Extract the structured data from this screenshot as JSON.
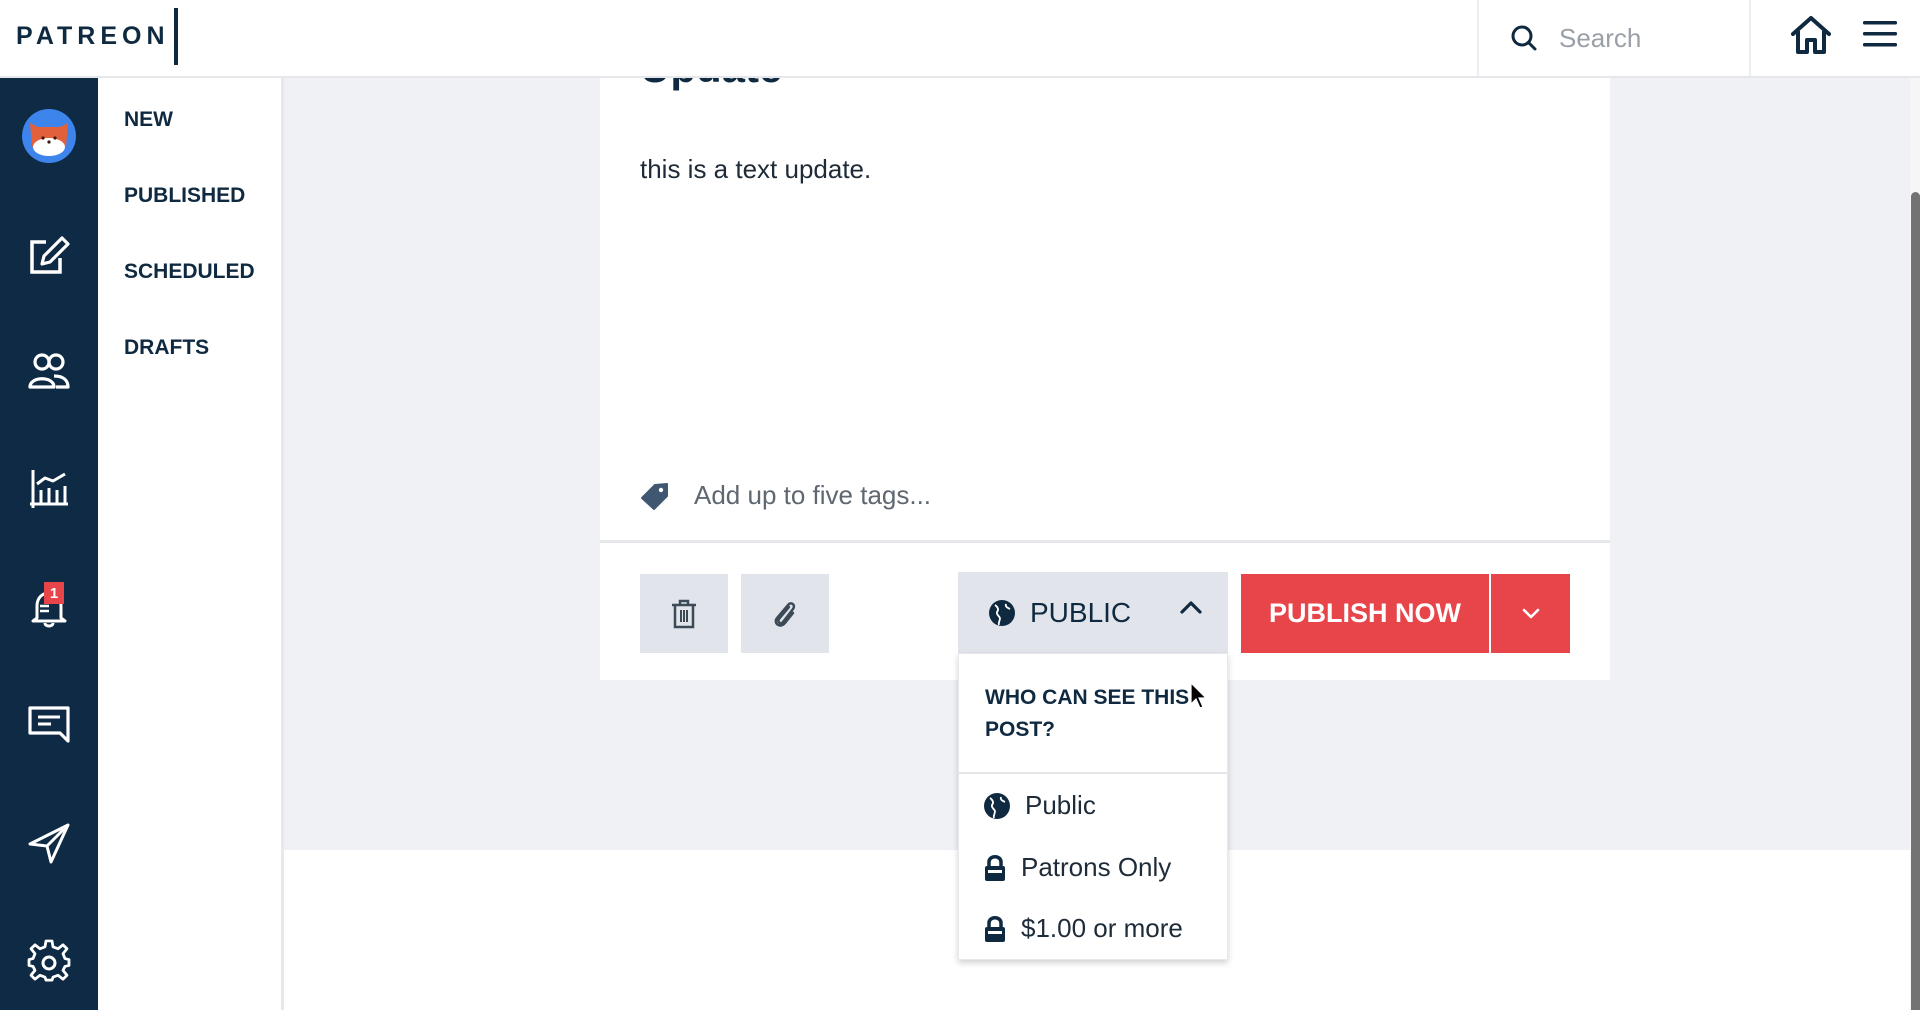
{
  "header": {
    "logo": "PATREON",
    "search": {
      "placeholder": "Search",
      "value": ""
    },
    "icons": [
      "search-icon",
      "home-icon",
      "hamburger-menu-icon"
    ]
  },
  "rail": {
    "items": [
      {
        "name": "avatar",
        "icon": "fox-avatar"
      },
      {
        "name": "posts",
        "icon": "edit-icon"
      },
      {
        "name": "patrons",
        "icon": "users-icon"
      },
      {
        "name": "insights",
        "icon": "chart-icon"
      },
      {
        "name": "notifications",
        "icon": "bell-icon",
        "badge": "1"
      },
      {
        "name": "messages",
        "icon": "message-icon"
      },
      {
        "name": "promote",
        "icon": "send-icon"
      },
      {
        "name": "settings",
        "icon": "gear-icon"
      }
    ]
  },
  "subnav": {
    "items": [
      {
        "label": "NEW"
      },
      {
        "label": "PUBLISHED"
      },
      {
        "label": "SCHEDULED"
      },
      {
        "label": "DRAFTS"
      }
    ]
  },
  "post": {
    "title": "Update",
    "body": "this is a text update.",
    "tags": {
      "placeholder": "Add up to five tags...",
      "value": ""
    }
  },
  "actions": {
    "delete_icon": "trash-icon",
    "attach_icon": "paperclip-icon",
    "privacy_label": "PUBLIC",
    "publish_label": "PUBLISH NOW"
  },
  "privacy_dropdown": {
    "header": "WHO CAN SEE THIS POST?",
    "options": [
      {
        "label": "Public",
        "icon": "globe-icon"
      },
      {
        "label": "Patrons Only",
        "icon": "lock-icon"
      },
      {
        "label": "$1.00 or more",
        "icon": "lock-icon"
      }
    ]
  },
  "colors": {
    "brand_navy": "#0e2a44",
    "publish_red": "#e8454b",
    "avatar_blue": "#3d84ed",
    "main_bg": "#f0f1f5",
    "button_gray": "#e1e5eb"
  }
}
